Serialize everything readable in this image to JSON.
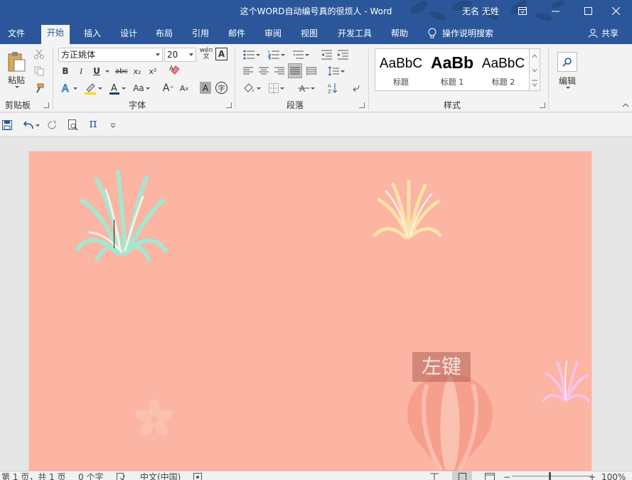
{
  "window": {
    "title": "这个WORD自动编号真的很烦人  -  Word",
    "user": "无名 无姓"
  },
  "tabs": [
    {
      "label": "文件"
    },
    {
      "label": "开始",
      "active": true
    },
    {
      "label": "插入"
    },
    {
      "label": "设计"
    },
    {
      "label": "布局"
    },
    {
      "label": "引用"
    },
    {
      "label": "邮件"
    },
    {
      "label": "审阅"
    },
    {
      "label": "视图"
    },
    {
      "label": "开发工具"
    },
    {
      "label": "帮助"
    }
  ],
  "tell_me": "操作说明搜索",
  "share": "共享",
  "clipboard": {
    "paste": "粘贴",
    "label": "剪贴板"
  },
  "font": {
    "name": "方正姚体",
    "size": "20",
    "label": "字体",
    "bold": "B",
    "italic": "I",
    "underline": "U",
    "strike": "abc",
    "sub": "x₂",
    "sup": "x²",
    "grow": "A",
    "shrink": "A",
    "case": "Aa",
    "phonetic": "wén",
    "phonetic2": "文",
    "shade": "A",
    "enclose": "字"
  },
  "paragraph": {
    "label": "段落"
  },
  "styles": {
    "label": "样式",
    "items": [
      {
        "sample": "AaBbC",
        "name": "标题"
      },
      {
        "sample": "AaBb",
        "name": "标题 1"
      },
      {
        "sample": "AaBbC",
        "name": "标题 2"
      }
    ]
  },
  "editing": {
    "label": "编辑"
  },
  "qat": {
    "pi": "π"
  },
  "document": {
    "balloon_label": "左键",
    "background": "#fcb4a3"
  },
  "status": {
    "page": "第 1 页，共 1 页",
    "words": "0 个字",
    "lang": "中文(中国)",
    "zoom": "100%"
  },
  "colors": {
    "accent": "#2b579a",
    "ribbon": "#f3f3f3"
  }
}
